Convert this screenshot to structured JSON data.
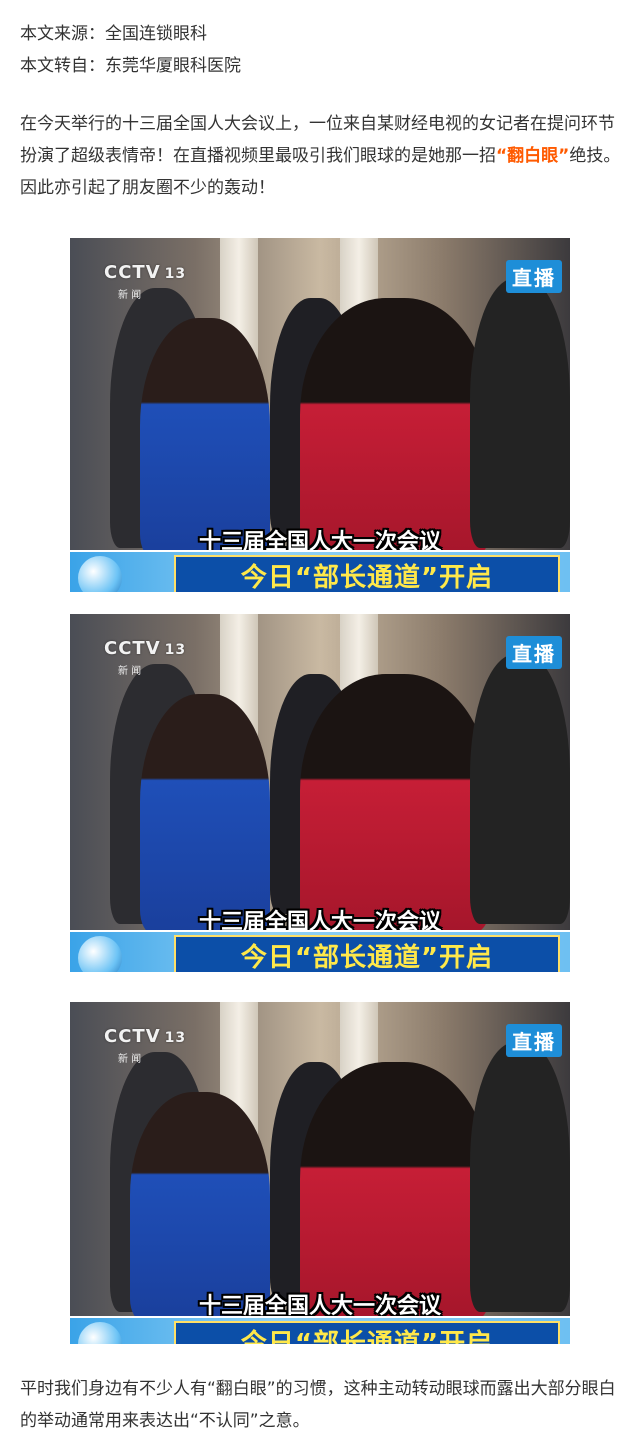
{
  "source": {
    "origin": "本文来源：全国连锁眼科",
    "repost": "本文转自：东莞华厦眼科医院"
  },
  "intro": {
    "before": "在今天举行的十三届全国人大会议上，一位来自某财经电视的女记者在提问环节扮演了超级表情帝！在直播视频里最吸引我们眼球的是她那一招",
    "highlight": "“翻白眼”",
    "after": "绝技。因此亦引起了朋友圈不少的轰动！"
  },
  "screenshots": [
    {
      "channel": "CCTV",
      "channel_number": "13",
      "channel_sub": "新 闻",
      "live_badge": "直播",
      "caption": "十三届全国人大一次会议",
      "banner": "今日“部长通道”开启"
    },
    {
      "channel": "CCTV",
      "channel_number": "13",
      "channel_sub": "新 闻",
      "live_badge": "直播",
      "caption": "十三届全国人大一次会议",
      "banner": "今日“部长通道”开启"
    },
    {
      "channel": "CCTV",
      "channel_number": "13",
      "channel_sub": "新 闻",
      "live_badge": "直播",
      "caption": "十三届全国人大一次会议",
      "banner": "今日“部长通道”开启"
    }
  ],
  "closing": "平时我们身边有不少人有“翻白眼”的习惯，这种主动转动眼球而露出大部分眼白的举动通常用来表达出“不认同”之意。",
  "colors": {
    "highlight": "#ff5a00",
    "text": "#333333",
    "live_badge": "#1e8ed8",
    "banner_text": "#ffe84a"
  }
}
